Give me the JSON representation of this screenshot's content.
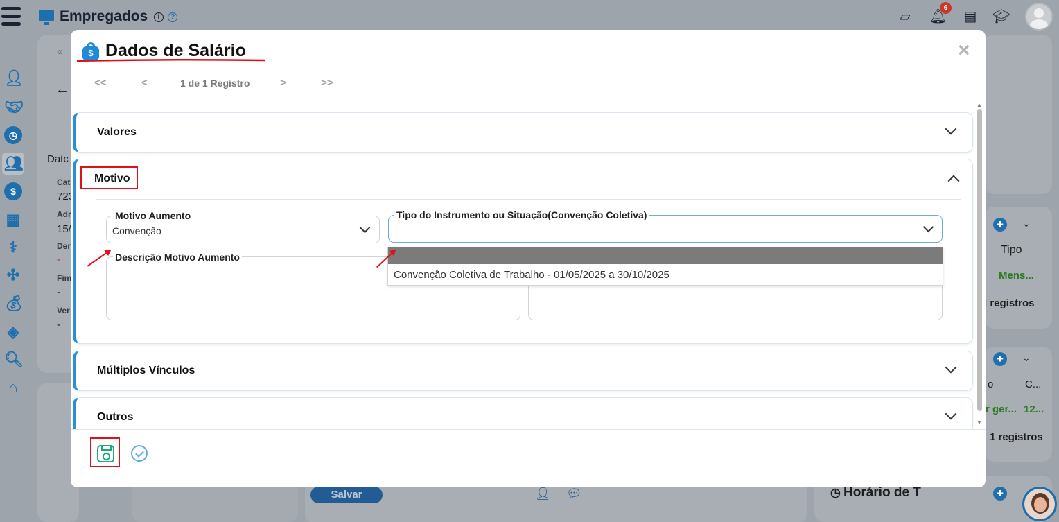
{
  "app": {
    "title": "Empregados",
    "notification_count": "6",
    "info_glyph": "i",
    "help_glyph": "?"
  },
  "background": {
    "partial_label": "Datc",
    "field_labels": [
      "Cat",
      "Adr",
      "Der",
      "Fim",
      "Ver"
    ],
    "field_values": [
      "723",
      "15/",
      "-",
      "-",
      "-"
    ],
    "right_table_1": {
      "col": "Tipo",
      "value": "Mens...",
      "footer": "l registros"
    },
    "right_table_2": {
      "col_a": "o",
      "col_b": "C...",
      "value_a": "r ger...",
      "value_b": "12...",
      "footer": "1 registros"
    },
    "horario_label": "Horário de T",
    "salvar_label": "Salvar"
  },
  "modal": {
    "title": "Dados de Salário",
    "bag_glyph": "$",
    "close_glyph": "×",
    "nav": {
      "first": "<<",
      "prev": "<",
      "label": "1 de 1 Registro",
      "next": ">",
      "last": ">>"
    },
    "sections": [
      {
        "title": "Valores",
        "expanded": false
      },
      {
        "title": "Motivo",
        "expanded": true
      },
      {
        "title": "Múltiplos Vínculos",
        "expanded": false
      },
      {
        "title": "Outros",
        "expanded": false
      }
    ],
    "motivo": {
      "motivo_aumento_label": "Motivo Aumento",
      "motivo_aumento_value": "Convenção",
      "tipo_instrumento_label": "Tipo do Instrumento ou Situação(Convenção Coletiva)",
      "tipo_instrumento_value": "",
      "descricao_label": "Descrição Motivo Aumento",
      "dropdown_options": [
        "",
        "Convenção Coletiva de Trabalho - 01/05/2025 a 30/10/2025"
      ]
    }
  },
  "colors": {
    "accent": "#2c8fd6",
    "save_green": "#1fa67a",
    "annotation_red": "#e0101a"
  }
}
